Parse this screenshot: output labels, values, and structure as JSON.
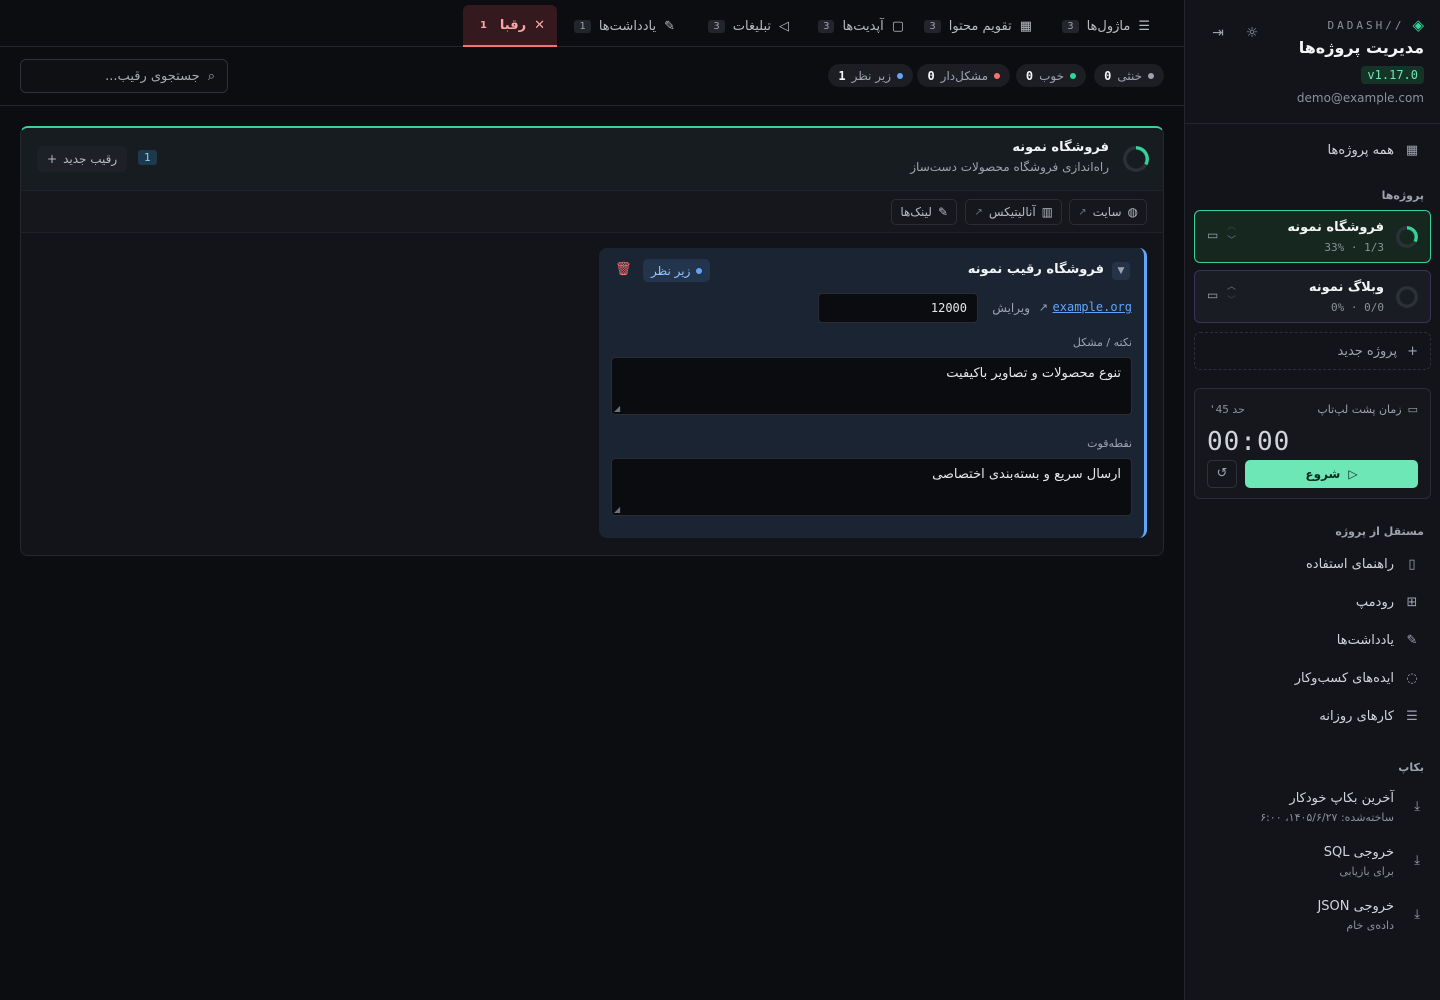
{
  "sidebar": {
    "brand": "//DADASH",
    "title": "مدیریت پروژه‌ها",
    "version": "v1.17.0",
    "email": "demo@example.com",
    "all_projects": "همه پروژه‌ها",
    "projects_label": "پروژه‌ها",
    "projects": [
      {
        "name": "فروشگاه نمونه",
        "meta": "33% · 1/3",
        "progress": 0.33
      },
      {
        "name": "وبلاگ نمونه",
        "meta": "0% · 0/0",
        "progress": 0
      }
    ],
    "new_project": "پروژه جدید",
    "timer": {
      "label": "زمان پشت لپ‌تاپ",
      "limit_prefix": "حد",
      "limit": "45'",
      "value": "00:00",
      "start": "شروع"
    },
    "independent_label": "مستقل از پروژه",
    "independent_items": [
      {
        "label": "راهنمای استفاده",
        "icon": "book-icon"
      },
      {
        "label": "رودمپ",
        "icon": "map-icon"
      },
      {
        "label": "یادداشت‌ها",
        "icon": "notes-icon"
      },
      {
        "label": "ایده‌های کسب‌وکار",
        "icon": "lightbulb-icon"
      },
      {
        "label": "کارهای روزانه",
        "icon": "checklist-icon"
      }
    ],
    "backup_label": "بکاپ",
    "backup_items": [
      {
        "title": "آخرین بکاپ خودکار",
        "sub": "ساخته‌شده: ۱۴۰۵/۶/۲۷، ۶:۰۰"
      },
      {
        "title": "خروجی SQL",
        "sub": "برای بازیابی"
      },
      {
        "title": "خروجی JSON",
        "sub": "داده‌ی خام"
      }
    ]
  },
  "tabs": [
    {
      "label": "ماژول‌ها",
      "count": "3"
    },
    {
      "label": "تقویم محتوا",
      "count": "3"
    },
    {
      "label": "آپدیت‌ها",
      "count": "3"
    },
    {
      "label": "تبلیغات",
      "count": "3"
    },
    {
      "label": "یادداشت‌ها",
      "count": "1"
    },
    {
      "label": "رقبا",
      "count": "1"
    }
  ],
  "filters": [
    {
      "label": "خنثی",
      "count": "0",
      "color": "#9ca3af"
    },
    {
      "label": "خوب",
      "count": "0",
      "color": "#34d399"
    },
    {
      "label": "مشکل‌دار",
      "count": "0",
      "color": "#f87171"
    },
    {
      "label": "زیر نظر",
      "count": "1",
      "color": "#60a5fa"
    }
  ],
  "search": {
    "placeholder": "جستجوی رقیب..."
  },
  "panel": {
    "title": "فروشگاه نمونه",
    "subtitle": "راه‌اندازی فروشگاه محصولات دست‌ساز",
    "count": "1",
    "new_competitor": "رقیب جدید",
    "progress": 0.33,
    "links": [
      {
        "label": "سایت",
        "icon": "globe-icon"
      },
      {
        "label": "آنالیتیکس",
        "icon": "chart-icon"
      },
      {
        "label": "لینک‌ها",
        "icon": "pencil-icon"
      }
    ]
  },
  "competitor": {
    "name": "فروشگاه رقیب نمونه",
    "status": "زیر نظر",
    "url": "example.org",
    "edit": "ویرایش",
    "price": "12000",
    "note_label": "نکته / مشکل",
    "note": "تنوع محصولات و تصاویر باکیفیت",
    "strength_label": "نقطه‌قوت",
    "strength": "ارسال سریع و بسته‌بندی اختصاصی"
  },
  "colors": {
    "accent": "#34d399",
    "danger": "#f87171",
    "info": "#60a5fa"
  }
}
